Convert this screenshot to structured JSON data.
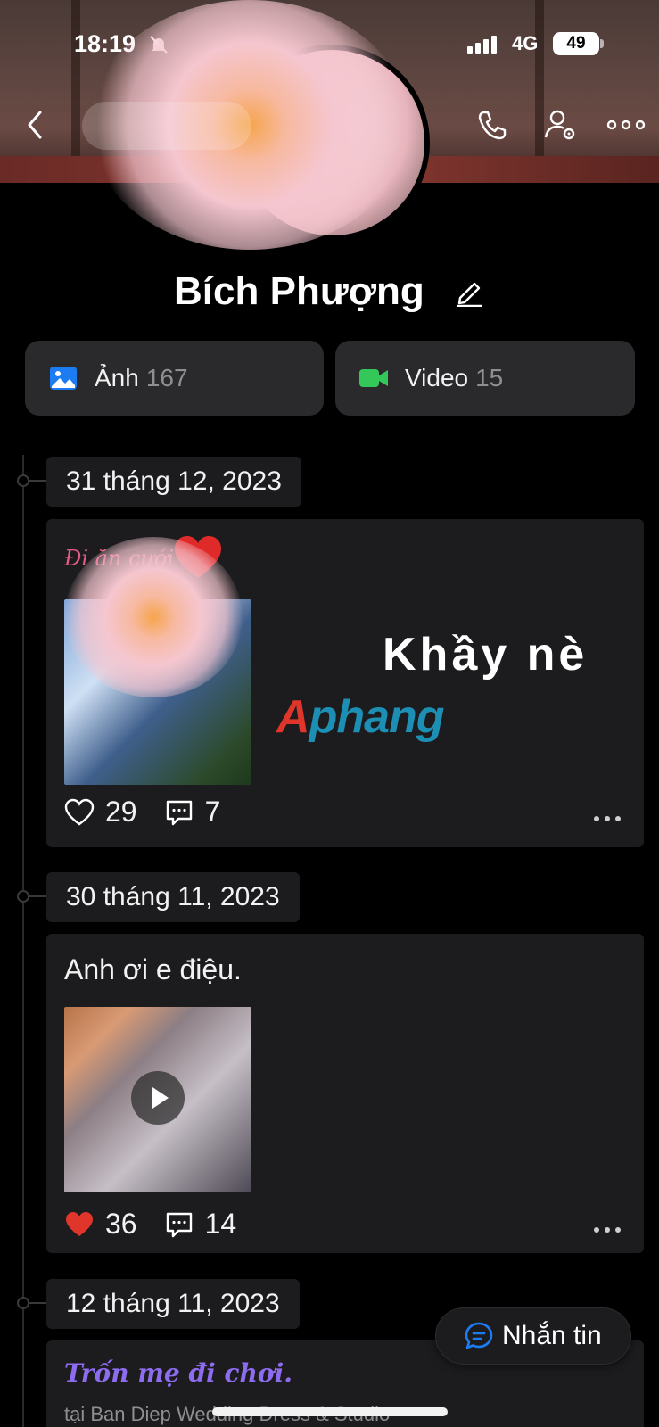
{
  "status_bar": {
    "time": "18:19",
    "network": "4G",
    "battery": "49"
  },
  "profile": {
    "name": "Bích Phượng"
  },
  "media": [
    {
      "label": "Ảnh",
      "count": "167",
      "icon": "photo-icon",
      "color": "#1c7cf4"
    },
    {
      "label": "Video",
      "count": "15",
      "icon": "video-icon",
      "color": "#34c759"
    }
  ],
  "posts": [
    {
      "date": "31 tháng 12, 2023",
      "caption": "Đi ăn cưới",
      "overlay_text": "Khầy nè",
      "watermark": "Aphang",
      "likes": "29",
      "comments": "7",
      "liked": false
    },
    {
      "date": "30 tháng 11, 2023",
      "text": "Anh ơi e điệu.",
      "likes": "36",
      "comments": "14",
      "liked": true,
      "is_video": true
    },
    {
      "date": "12 tháng 11, 2023",
      "caption": "Trốn mẹ đi chơi.",
      "location": "tại Ban Diep Wedding Dress & Studio"
    }
  ],
  "fab": {
    "label": "Nhắn tin"
  },
  "colors": {
    "accent": "#1c7cf4",
    "like_red": "#e0352a",
    "card_bg": "#1c1c1e"
  }
}
